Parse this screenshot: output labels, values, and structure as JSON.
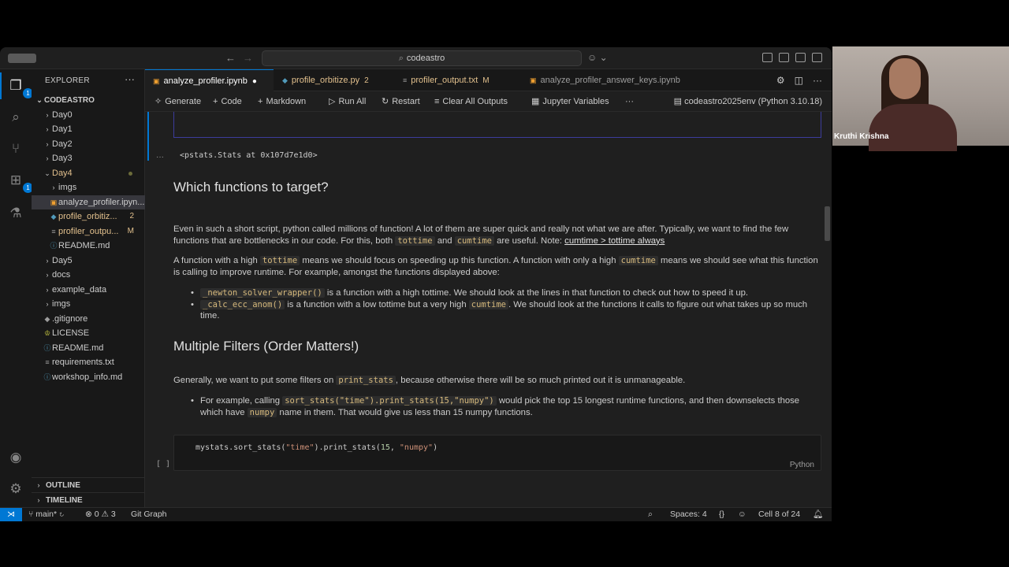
{
  "titlebar": {
    "search": "codeastro"
  },
  "sidebar": {
    "title": "EXPLORER",
    "root": "CODEASTRO",
    "items": [
      {
        "label": "Day0",
        "type": "folder",
        "open": false,
        "depth": 1
      },
      {
        "label": "Day1",
        "type": "folder",
        "open": false,
        "depth": 1
      },
      {
        "label": "Day2",
        "type": "folder",
        "open": false,
        "depth": 1
      },
      {
        "label": "Day3",
        "type": "folder",
        "open": false,
        "depth": 1
      },
      {
        "label": "Day4",
        "type": "folder",
        "open": true,
        "depth": 1
      },
      {
        "label": "imgs",
        "type": "folder",
        "open": false,
        "depth": 2
      },
      {
        "label": "analyze_profiler.ipyn...",
        "type": "notebook",
        "depth": 2
      },
      {
        "label": "profile_orbitiz...",
        "type": "python",
        "depth": 2,
        "badge": "2"
      },
      {
        "label": "profiler_outpu...",
        "type": "text",
        "depth": 2,
        "badge": "M"
      },
      {
        "label": "README.md",
        "type": "md",
        "depth": 2
      },
      {
        "label": "Day5",
        "type": "folder",
        "open": false,
        "depth": 1
      },
      {
        "label": "docs",
        "type": "folder",
        "open": false,
        "depth": 1
      },
      {
        "label": "example_data",
        "type": "folder",
        "open": false,
        "depth": 1
      },
      {
        "label": "imgs",
        "type": "folder",
        "open": false,
        "depth": 1
      },
      {
        "label": ".gitignore",
        "type": "git",
        "depth": 1
      },
      {
        "label": "LICENSE",
        "type": "license",
        "depth": 1
      },
      {
        "label": "README.md",
        "type": "md",
        "depth": 1
      },
      {
        "label": "requirements.txt",
        "type": "text",
        "depth": 1
      },
      {
        "label": "workshop_info.md",
        "type": "md",
        "depth": 1
      }
    ],
    "outline": "OUTLINE",
    "timeline": "TIMELINE"
  },
  "tabs": [
    {
      "label": "analyze_profiler.ipynb",
      "mark": "●"
    },
    {
      "label": "profile_orbitize.py",
      "mark": "2"
    },
    {
      "label": "profiler_output.txt",
      "mark": "M"
    },
    {
      "label": "analyze_profiler_answer_keys.ipynb",
      "mark": ""
    }
  ],
  "toolbar": {
    "generate": "Generate",
    "code": "Code",
    "markdown": "Markdown",
    "run_all": "Run All",
    "restart": "Restart",
    "clear_outputs": "Clear All Outputs",
    "variables": "Jupyter Variables",
    "more": "···",
    "kernel": "codeastro2025env (Python 3.10.18)"
  },
  "notebook": {
    "output_text": "<pstats.Stats at 0x107d7e1d0>",
    "h_target": "Which functions to target?",
    "p1_a": "Even in such a short script, python called millions of function! A lot of them are super quick and really not what we are after. Typically, we want to find the few functions that are bottlenecks in our code. For this, both",
    "p1_code1": "tottime",
    "p1_and": "and",
    "p1_code2": "cumtime",
    "p1_b": "are useful. Note:",
    "p1_link": "cumtime > tottime always",
    "p2_a": "A function with a high",
    "p2_code1": "tottime",
    "p2_b": "means we should focus on speeding up this function. A function with only a high",
    "p2_code2": "cumtime",
    "p2_c": "means we should see what this function is calling to improve runtime. For example, amongst the functions displayed above:",
    "b1_code": "_newton_solver_wrapper()",
    "b1_text": "is a function with a high tottime. We should look at the lines in that function to check out how to speed it up.",
    "b2_code": "_calc_ecc_anom()",
    "b2_a": "is a function with a low tottime but a very high",
    "b2_code2": "cumtime",
    "b2_b": ". We should look at the functions it calls to figure out what takes up so much time.",
    "h_filters": "Multiple Filters (Order Matters!)",
    "p3_a": "Generally, we want to put some filters on",
    "p3_code": "print_stats",
    "p3_b": ", because otherwise there will be so much printed out it is unmanageable.",
    "b3_a": "For example, calling",
    "b3_code": "sort_stats(\"time\").print_stats(15,\"numpy\")",
    "b3_b": "would pick the top 15 longest runtime functions, and then downselects those which have",
    "b3_code2": "numpy",
    "b3_c": "name in them. That would give us less than 15 numpy functions.",
    "code_a": "mystats.sort_stats(",
    "code_s1": "\"time\"",
    "code_b": ").print_stats(",
    "code_n": "15",
    "code_c": ", ",
    "code_s2": "\"numpy\"",
    "code_d": ")",
    "code_lang": "Python",
    "exec_marker": "[ ]",
    "out_marker": "···"
  },
  "statusbar": {
    "branch": "main*",
    "errors": "0",
    "warnings": "3",
    "git_graph": "Git Graph",
    "spaces": "Spaces: 4",
    "braces": "{}",
    "cell": "Cell 8 of 24"
  },
  "video": {
    "name": "Kruthi Krishna"
  },
  "colors": {
    "accent": "#0078d4",
    "editor_bg": "#1f1f1f",
    "sidebar_bg": "#181818",
    "code_fg": "#d7ba7d"
  }
}
